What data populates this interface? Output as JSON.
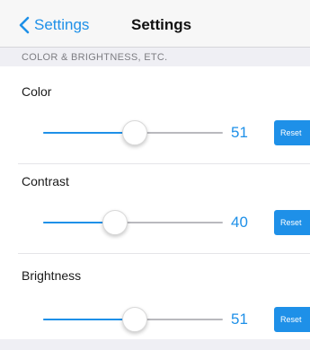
{
  "navbar": {
    "back_label": "Settings",
    "title": "Settings"
  },
  "section": {
    "header": "COLOR & BRIGHTNESS, ETC."
  },
  "settings": [
    {
      "label": "Color",
      "value": 51,
      "value_text": "51",
      "reset_label": "Reset"
    },
    {
      "label": "Contrast",
      "value": 40,
      "value_text": "40",
      "reset_label": "Reset"
    },
    {
      "label": "Brightness",
      "value": 51,
      "value_text": "51",
      "reset_label": "Reset"
    }
  ],
  "colors": {
    "accent": "#1e90e8",
    "track": "#b9b9be",
    "section_bg": "#efeff4",
    "navbar_bg": "#f7f7f7"
  },
  "icons": {
    "back": "chevron-left-icon",
    "thumb": "slider-thumb"
  }
}
